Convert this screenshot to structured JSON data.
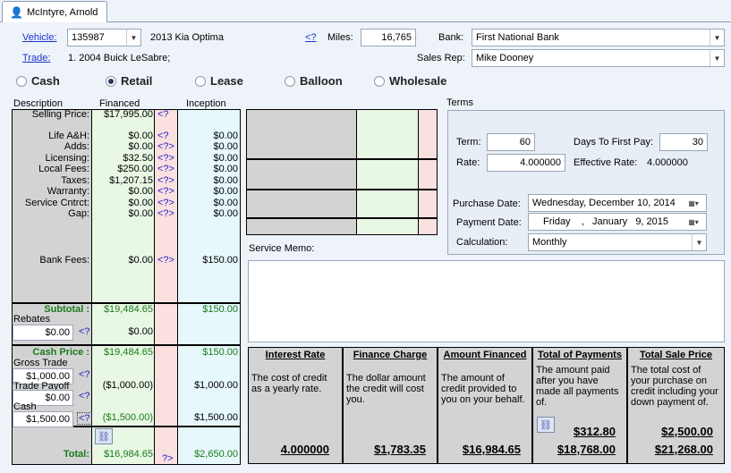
{
  "tab": {
    "label": "McIntyre, Arnold"
  },
  "vehicle": {
    "label": "Vehicle:",
    "value": "135987",
    "description": "2013 Kia Optima"
  },
  "trade": {
    "label": "Trade:",
    "description": "1. 2004 Buick LeSabre;"
  },
  "miles": {
    "help": "<?",
    "label": "Miles:",
    "value": "16,765"
  },
  "bank": {
    "label": "Bank:",
    "value": "First National Bank"
  },
  "sales_rep": {
    "label": "Sales Rep:",
    "value": "Mike Dooney"
  },
  "deal_types": [
    {
      "label": "Cash",
      "selected": false
    },
    {
      "label": "Retail",
      "selected": true
    },
    {
      "label": "Lease",
      "selected": false
    },
    {
      "label": "Balloon",
      "selected": false
    },
    {
      "label": "Wholesale",
      "selected": false
    }
  ],
  "columns": {
    "description": "Description",
    "financed": "Financed",
    "inception": "Inception"
  },
  "rows": [
    {
      "label": "Selling Price:",
      "financed": "$17,995.00",
      "q": "<?",
      "inception": ""
    },
    {
      "label": "Life A&H:",
      "financed": "$0.00",
      "q": "<?",
      "inception": "$0.00"
    },
    {
      "label": "Adds:",
      "financed": "$0.00",
      "q": "<?>",
      "inception": "$0.00"
    },
    {
      "label": "Licensing:",
      "financed": "$32.50",
      "q": "<?>",
      "inception": "$0.00"
    },
    {
      "label": "Local Fees:",
      "financed": "$250.00",
      "q": "<?>",
      "inception": "$0.00"
    },
    {
      "label": "Taxes:",
      "financed": "$1,207.15",
      "q": "<?>",
      "inception": "$0.00"
    },
    {
      "label": "Warranty:",
      "financed": "$0.00",
      "q": "<?>",
      "inception": "$0.00"
    },
    {
      "label": "Service Cntrct:",
      "financed": "$0.00",
      "q": "<?>",
      "inception": "$0.00"
    },
    {
      "label": "Gap:",
      "financed": "$0.00",
      "q": "<?>",
      "inception": "$0.00"
    },
    {
      "label": "Bank Fees:",
      "financed": "$0.00",
      "q": "<?>",
      "inception": "$150.00"
    }
  ],
  "subtotal": {
    "label": "Subtotal :",
    "financed": "$19,484.65",
    "inception": "$150.00"
  },
  "rebates": {
    "label": "Rebates",
    "value": "$0.00",
    "q": "<?",
    "financed": "$0.00"
  },
  "cash_price": {
    "label": "Cash Price :",
    "financed": "$19,484.65",
    "inception": "$150.00"
  },
  "gross_trade": {
    "label": "Gross Trade",
    "value": "$1,000.00",
    "q": "<?"
  },
  "trade_payoff": {
    "label": "Trade Payoff",
    "value": "$0.00",
    "q": "<?",
    "financed": "($1,000.00)",
    "inception": "$1,000.00"
  },
  "cash": {
    "label": "Cash",
    "value": "$1,500.00",
    "q": "<?",
    "financed": "($1,500.00)",
    "inception": "$1,500.00"
  },
  "total": {
    "label": "Total:",
    "financed": "$16,984.65",
    "q": "?>",
    "inception": "$2,650.00"
  },
  "terms": {
    "title": "Terms",
    "term_label": "Term:",
    "term": "60",
    "days_label": "Days To First Pay:",
    "days": "30",
    "rate_label": "Rate:",
    "rate": "4.000000",
    "eff_label": "Effective Rate:",
    "eff": "4.000000",
    "purchase_label": "Purchase Date:",
    "purchase_date": "Wednesday, December 10, 2014",
    "payment_label": "Payment Date:",
    "payment_date": "Friday    ,   January   9, 2015",
    "calc_label": "Calculation:",
    "calc": "Monthly"
  },
  "service_memo": {
    "label": "Service Memo:"
  },
  "tila": [
    {
      "title": "Interest Rate",
      "desc": "The cost of credit as a yearly rate.",
      "value": "4.000000"
    },
    {
      "title": "Finance Charge",
      "desc": "The dollar amount the credit will cost you.",
      "value": "$1,783.35"
    },
    {
      "title": "Amount Financed",
      "desc": "The amount of credit provided to you on your behalf.",
      "value": "$16,984.65"
    },
    {
      "title": "Total of Payments",
      "desc": "The amount paid after you have made all payments of.",
      "payment": "$312.80",
      "value": "$18,768.00"
    },
    {
      "title": "Total Sale Price",
      "desc": "The total cost of your purchase on credit including your down payment of.",
      "down": "$2,500.00",
      "value": "$21,268.00"
    }
  ]
}
